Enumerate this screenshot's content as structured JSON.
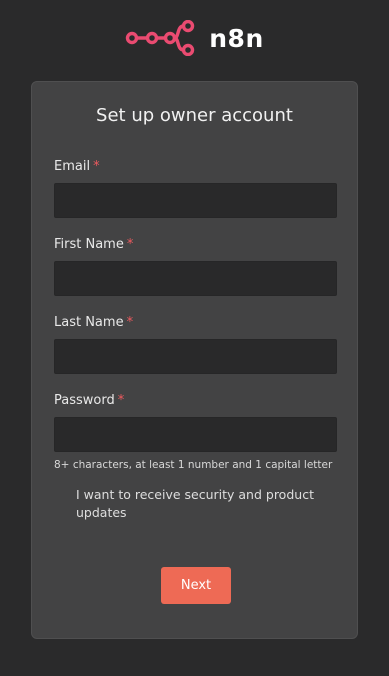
{
  "brand": {
    "name": "n8n",
    "logo_icon": "n8n-logo-icon",
    "accent_color": "#ea4b71"
  },
  "form": {
    "title": "Set up owner account",
    "required_marker": "*",
    "fields": [
      {
        "label": "Email",
        "value": "",
        "placeholder": ""
      },
      {
        "label": "First Name",
        "value": "",
        "placeholder": ""
      },
      {
        "label": "Last Name",
        "value": "",
        "placeholder": ""
      },
      {
        "label": "Password",
        "value": "",
        "placeholder": ""
      }
    ],
    "password_hint": "8+ characters, at least 1 number and 1 capital letter",
    "updates_checkbox": {
      "label": "I want to receive security and product updates",
      "checked": false
    },
    "next_label": "Next",
    "button_color": "#ee6a55"
  }
}
